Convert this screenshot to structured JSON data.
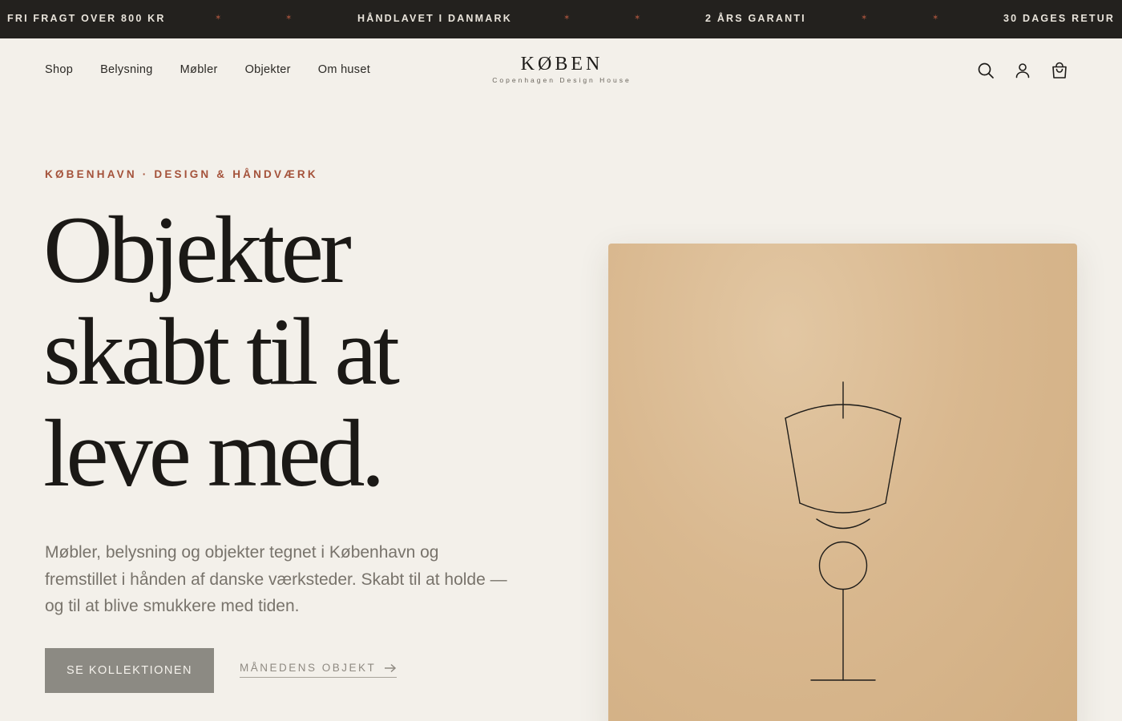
{
  "announcement": {
    "items": [
      "FRI FRAGT OVER 800 KR",
      "HÅNDLAVET I DANMARK",
      "2 ÅRS GARANTI",
      "30 DAGES RETUR"
    ],
    "separator": "✶"
  },
  "header": {
    "nav": [
      "Shop",
      "Belysning",
      "Møbler",
      "Objekter",
      "Om huset"
    ],
    "logo": {
      "wordmark": "KØBEN",
      "tagline": "Copenhagen Design House"
    },
    "icons": [
      "search-icon",
      "account-icon",
      "bag-icon"
    ]
  },
  "hero": {
    "eyebrow": "KØBENHAVN · DESIGN & HÅNDVÆRK",
    "headline_lines": [
      "Objekter",
      "skabt til at",
      "leve med."
    ],
    "lede": "Møbler, belysning og objekter tegnet i København og fremstillet i hånden af danske værksteder. Skabt til at holde — og til at blive smukkere med tiden.",
    "cta_primary": "SE KOLLEKTIONEN",
    "cta_secondary": "MÅNEDENS OBJEKT",
    "cta_secondary_icon": "arrow-right-icon",
    "image": {
      "subject": "lamp-illustration",
      "colors": {
        "background": "#d9b88f",
        "line": "#1f1d1a"
      }
    }
  },
  "colors": {
    "page_bg": "#f3f0ea",
    "announcement_bg": "#23211e",
    "accent": "#a4523a",
    "button_bg": "#8c8a83"
  }
}
